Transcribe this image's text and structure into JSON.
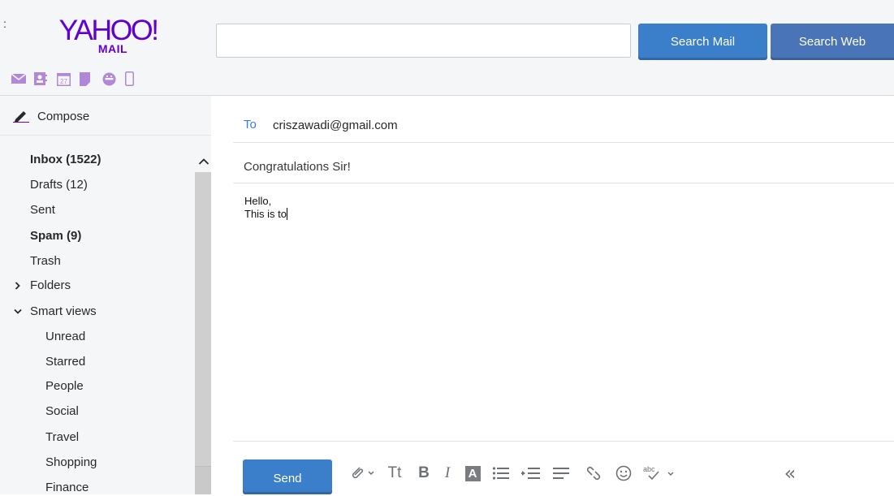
{
  "header": {
    "corner_mark": ":",
    "logo_text": "YAHOO!",
    "logo_subtext": "MAIL",
    "search": {
      "value": "",
      "placeholder": ""
    },
    "search_mail_label": "Search Mail",
    "search_web_label": "Search Web",
    "app_icons": [
      "mail-icon",
      "contacts-icon",
      "calendar-icon",
      "notepad-icon",
      "messenger-icon",
      "mobile-icon"
    ],
    "calendar_day": "27"
  },
  "sidebar": {
    "compose_label": "Compose",
    "items": [
      {
        "label": "Inbox (1522)"
      },
      {
        "label": "Drafts (12)"
      },
      {
        "label": "Sent"
      },
      {
        "label": "Spam (9)"
      },
      {
        "label": "Trash"
      },
      {
        "label": "Folders"
      },
      {
        "label": "Smart views"
      },
      {
        "label": "Unread"
      },
      {
        "label": "Starred"
      },
      {
        "label": "People"
      },
      {
        "label": "Social"
      },
      {
        "label": "Travel"
      },
      {
        "label": "Shopping"
      },
      {
        "label": "Finance"
      }
    ]
  },
  "compose": {
    "to_label": "To",
    "to_value": "criszawadi@gmail.com",
    "subject": "Congratulations Sir!",
    "body_line1": "Hello,",
    "body_line2": "This is to",
    "send_label": "Send"
  },
  "toolbar": {
    "font_size_label": "Tt",
    "bold_label": "B",
    "italic_label": "I",
    "background_label": "A",
    "spellcheck_label": "abc",
    "collapse_label": "«"
  },
  "colors": {
    "accent": "#3b7ec9",
    "brand": "#6001d2",
    "app_icon": "#b187d8"
  }
}
